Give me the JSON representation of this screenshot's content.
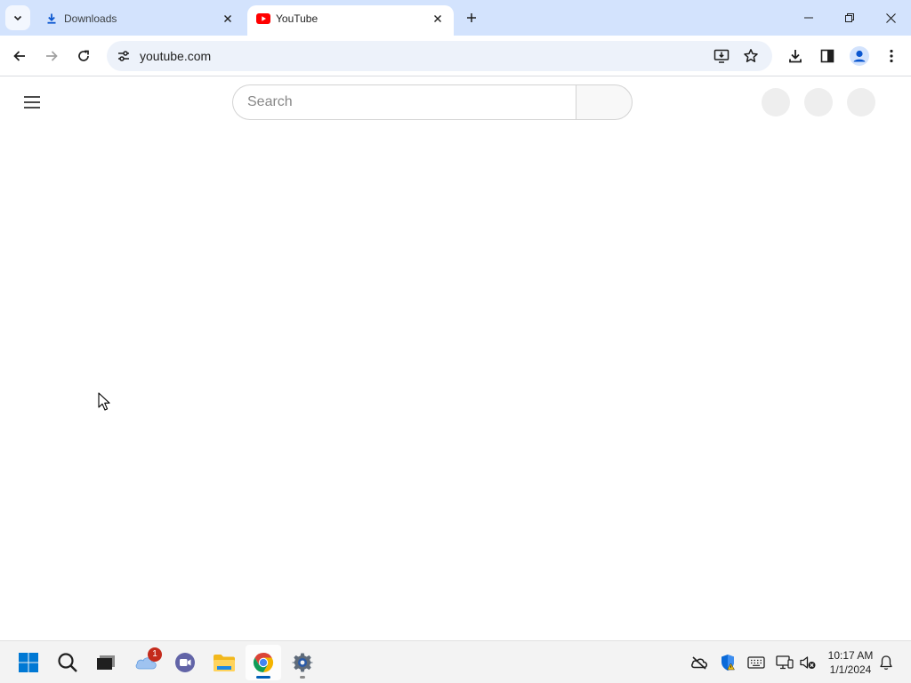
{
  "browser": {
    "tabs": [
      {
        "title": "Downloads",
        "icon": "download-icon",
        "active": false
      },
      {
        "title": "YouTube",
        "icon": "youtube-icon",
        "active": true
      }
    ],
    "address": "youtube.com"
  },
  "page": {
    "search_placeholder": "Search"
  },
  "taskbar": {
    "onedrive_badge": "1",
    "time": "10:17 AM",
    "date": "1/1/2024"
  },
  "colors": {
    "tabstrip": "#d3e3fd",
    "omnibox": "#edf2fa",
    "youtube_red": "#ff0000",
    "taskbar_accent": "#005fb8"
  }
}
